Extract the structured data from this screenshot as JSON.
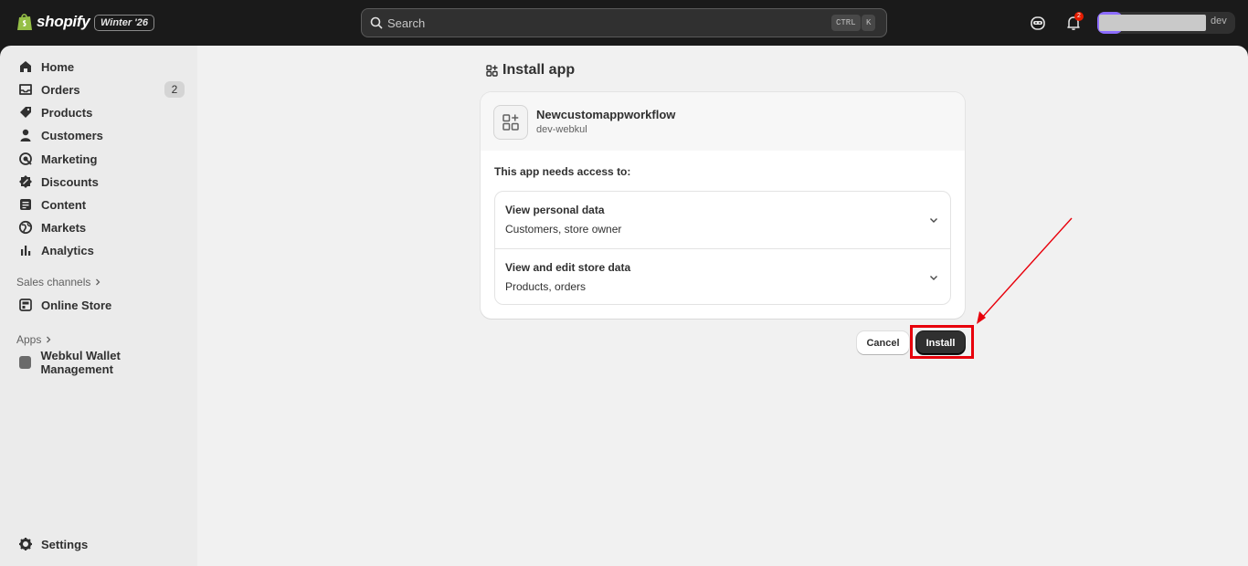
{
  "topbar": {
    "brand": "shopify",
    "edition_badge": "Winter '26",
    "search_placeholder": "Search",
    "shortcut_ctrl": "CTRL",
    "shortcut_k": "K",
    "notification_count": "2",
    "store_suffix": "dev"
  },
  "sidebar": {
    "items": [
      {
        "label": "Home",
        "icon": "home-icon"
      },
      {
        "label": "Orders",
        "icon": "inbox-icon",
        "count": "2"
      },
      {
        "label": "Products",
        "icon": "tag-icon"
      },
      {
        "label": "Customers",
        "icon": "person-icon"
      },
      {
        "label": "Marketing",
        "icon": "target-icon"
      },
      {
        "label": "Discounts",
        "icon": "discount-icon"
      },
      {
        "label": "Content",
        "icon": "content-icon"
      },
      {
        "label": "Markets",
        "icon": "globe-icon"
      },
      {
        "label": "Analytics",
        "icon": "bar-chart-icon"
      }
    ],
    "sales_channels_label": "Sales channels",
    "online_store_label": "Online Store",
    "apps_label": "Apps",
    "app_item_label": "Webkul Wallet Management",
    "settings_label": "Settings"
  },
  "page": {
    "title": "Install app",
    "app_name": "Newcustomappworkflow",
    "developer": "dev-webkul",
    "access_title": "This app needs access to:",
    "permissions": [
      {
        "title": "View personal data",
        "description": "Customers, store owner"
      },
      {
        "title": "View and edit store data",
        "description": "Products, orders"
      }
    ],
    "cancel_label": "Cancel",
    "install_label": "Install"
  },
  "colors": {
    "topbar_bg": "#1a1a1a",
    "sidebar_bg": "#ebebeb",
    "main_bg": "#f1f1f1",
    "primary_button": "#303030",
    "annotation_red": "#e8000b"
  }
}
